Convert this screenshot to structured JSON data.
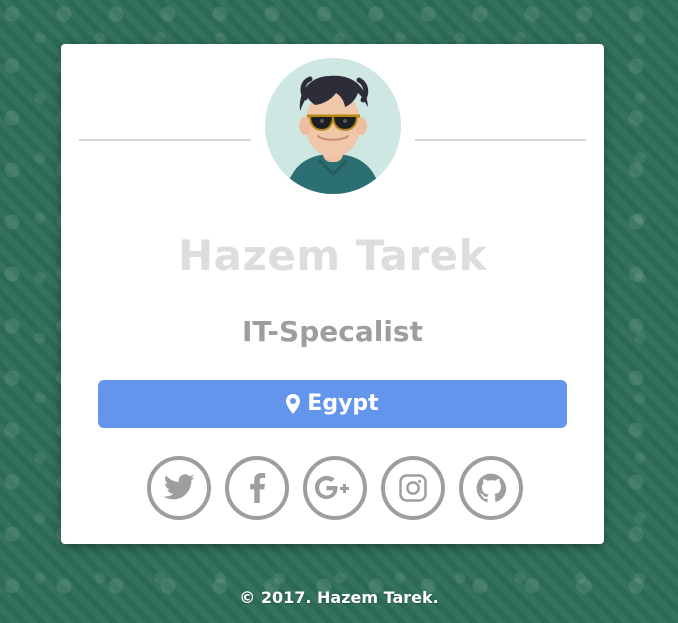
{
  "profile": {
    "name": "Hazem Tarek",
    "role": "IT-Specalist",
    "location": "Egypt"
  },
  "social": [
    {
      "icon": "twitter-icon"
    },
    {
      "icon": "facebook-icon"
    },
    {
      "icon": "google-plus-icon"
    },
    {
      "icon": "instagram-icon"
    },
    {
      "icon": "github-icon"
    }
  ],
  "footer": {
    "text": "© 2017. Hazem Tarek."
  },
  "colors": {
    "background": "#2b6a57",
    "card": "#ffffff",
    "name": "#dddddd",
    "role": "#9e9e9e",
    "location_bg": "#6495ed",
    "social_stroke": "#9e9e9e",
    "footer_text": "#ffffff"
  }
}
